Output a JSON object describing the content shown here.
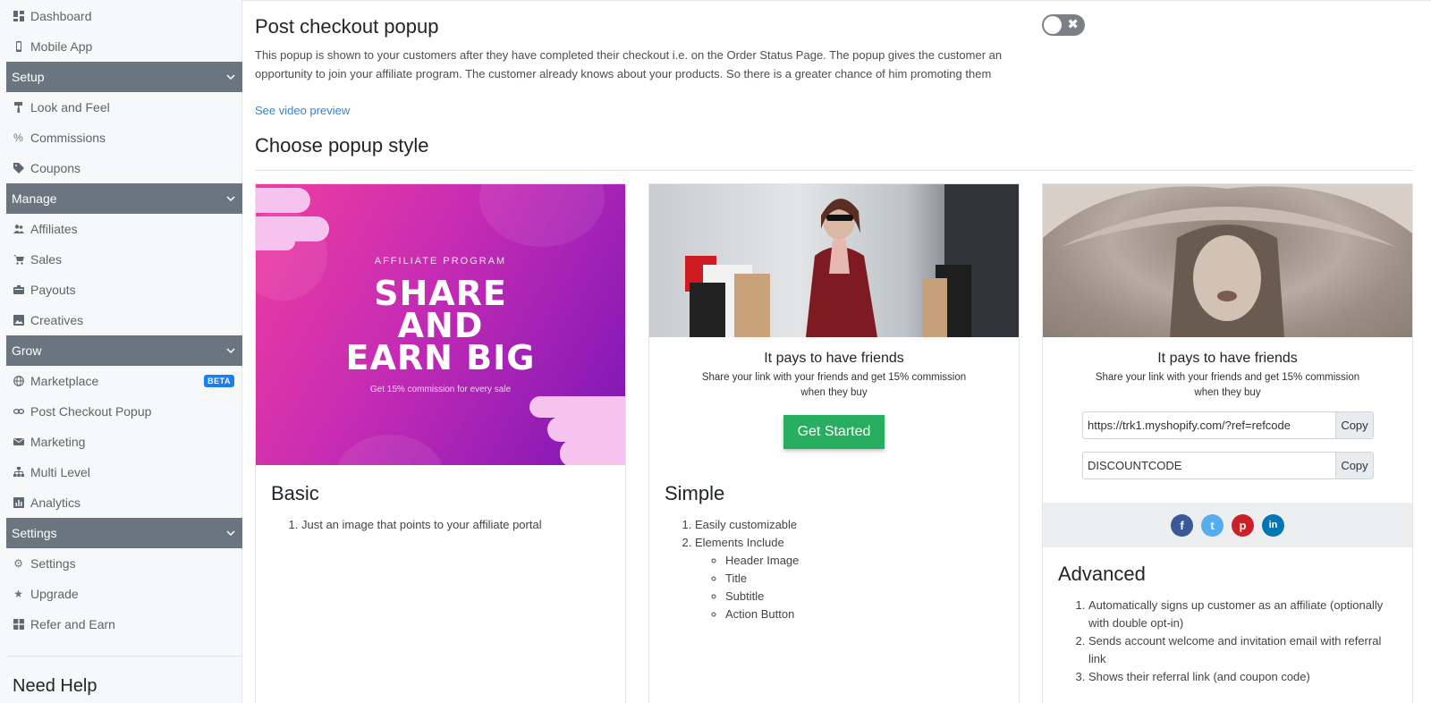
{
  "sidebar": {
    "top_items": [
      {
        "label": "Dashboard",
        "icon": "dashboard-icon"
      },
      {
        "label": "Mobile App",
        "icon": "mobile-icon"
      }
    ],
    "sections": [
      {
        "title": "Setup",
        "items": [
          {
            "label": "Look and Feel",
            "icon": "paint-roller-icon"
          },
          {
            "label": "Commissions",
            "icon": "percent-icon"
          },
          {
            "label": "Coupons",
            "icon": "tags-icon"
          }
        ]
      },
      {
        "title": "Manage",
        "items": [
          {
            "label": "Affiliates",
            "icon": "users-icon"
          },
          {
            "label": "Sales",
            "icon": "cart-icon"
          },
          {
            "label": "Payouts",
            "icon": "payouts-icon"
          },
          {
            "label": "Creatives",
            "icon": "image-icon"
          }
        ]
      },
      {
        "title": "Grow",
        "items": [
          {
            "label": "Marketplace",
            "icon": "globe-icon",
            "badge": "BETA"
          },
          {
            "label": "Post Checkout Popup",
            "icon": "link-icon"
          },
          {
            "label": "Marketing",
            "icon": "envelope-icon"
          },
          {
            "label": "Multi Level",
            "icon": "sitemap-icon"
          },
          {
            "label": "Analytics",
            "icon": "chart-icon"
          }
        ]
      },
      {
        "title": "Settings",
        "items": [
          {
            "label": "Settings",
            "icon": "gear-icon"
          },
          {
            "label": "Upgrade",
            "icon": "star-icon"
          },
          {
            "label": "Refer and Earn",
            "icon": "gift-icon"
          }
        ]
      }
    ],
    "need_help": "Need Help"
  },
  "main": {
    "title": "Post checkout popup",
    "description": "This popup is shown to your customers after they have completed their checkout i.e. on the Order Status Page. The popup gives the customer an opportunity to join your affiliate program. The customer already knows about your products. So there is a greater chance of him promoting them",
    "video_link": "See video preview",
    "toggle_state": "off",
    "style_heading": "Choose popup style"
  },
  "cards": {
    "basic": {
      "promo_eyebrow": "AFFILIATE PROGRAM",
      "promo_line1": "SHARE",
      "promo_line2": "AND",
      "promo_line3": "EARN BIG",
      "promo_sub": "Get 15% commission for every sale",
      "title": "Basic",
      "features": [
        "Just an image that points to your affiliate portal"
      ]
    },
    "simple": {
      "popup_title": "It pays to have friends",
      "popup_sub": "Share your link with your friends and get 15% commission when they buy",
      "cta": "Get Started",
      "title": "Simple",
      "features": [
        "Easily customizable",
        "Elements Include"
      ],
      "elements": [
        "Header Image",
        "Title",
        "Subtitle",
        "Action Button"
      ]
    },
    "advanced": {
      "popup_title": "It pays to have friends",
      "popup_sub": "Share your link with your friends and get 15% commission when they buy",
      "link_value": "https://trk1.myshopify.com/?ref=refcode",
      "code_value": "DISCOUNTCODE",
      "copy_label": "Copy",
      "social": [
        {
          "name": "facebook-icon",
          "glyph": "f",
          "color": "#3b5998"
        },
        {
          "name": "twitter-icon",
          "glyph": "t",
          "color": "#55acee"
        },
        {
          "name": "pinterest-icon",
          "glyph": "p",
          "color": "#cb2027"
        },
        {
          "name": "linkedin-icon",
          "glyph": "in",
          "color": "#0077b5"
        }
      ],
      "title": "Advanced",
      "features": [
        "Automatically signs up customer as an affiliate (optionally with double opt-in)",
        "Sends account welcome and invitation email with referral link",
        "Shows their referral link (and coupon code)"
      ]
    }
  },
  "colors": {
    "section_bg": "#6b7580",
    "accent_link": "#2e86de",
    "cta_green": "#27ae60",
    "badge_blue": "#1b7ff0"
  }
}
